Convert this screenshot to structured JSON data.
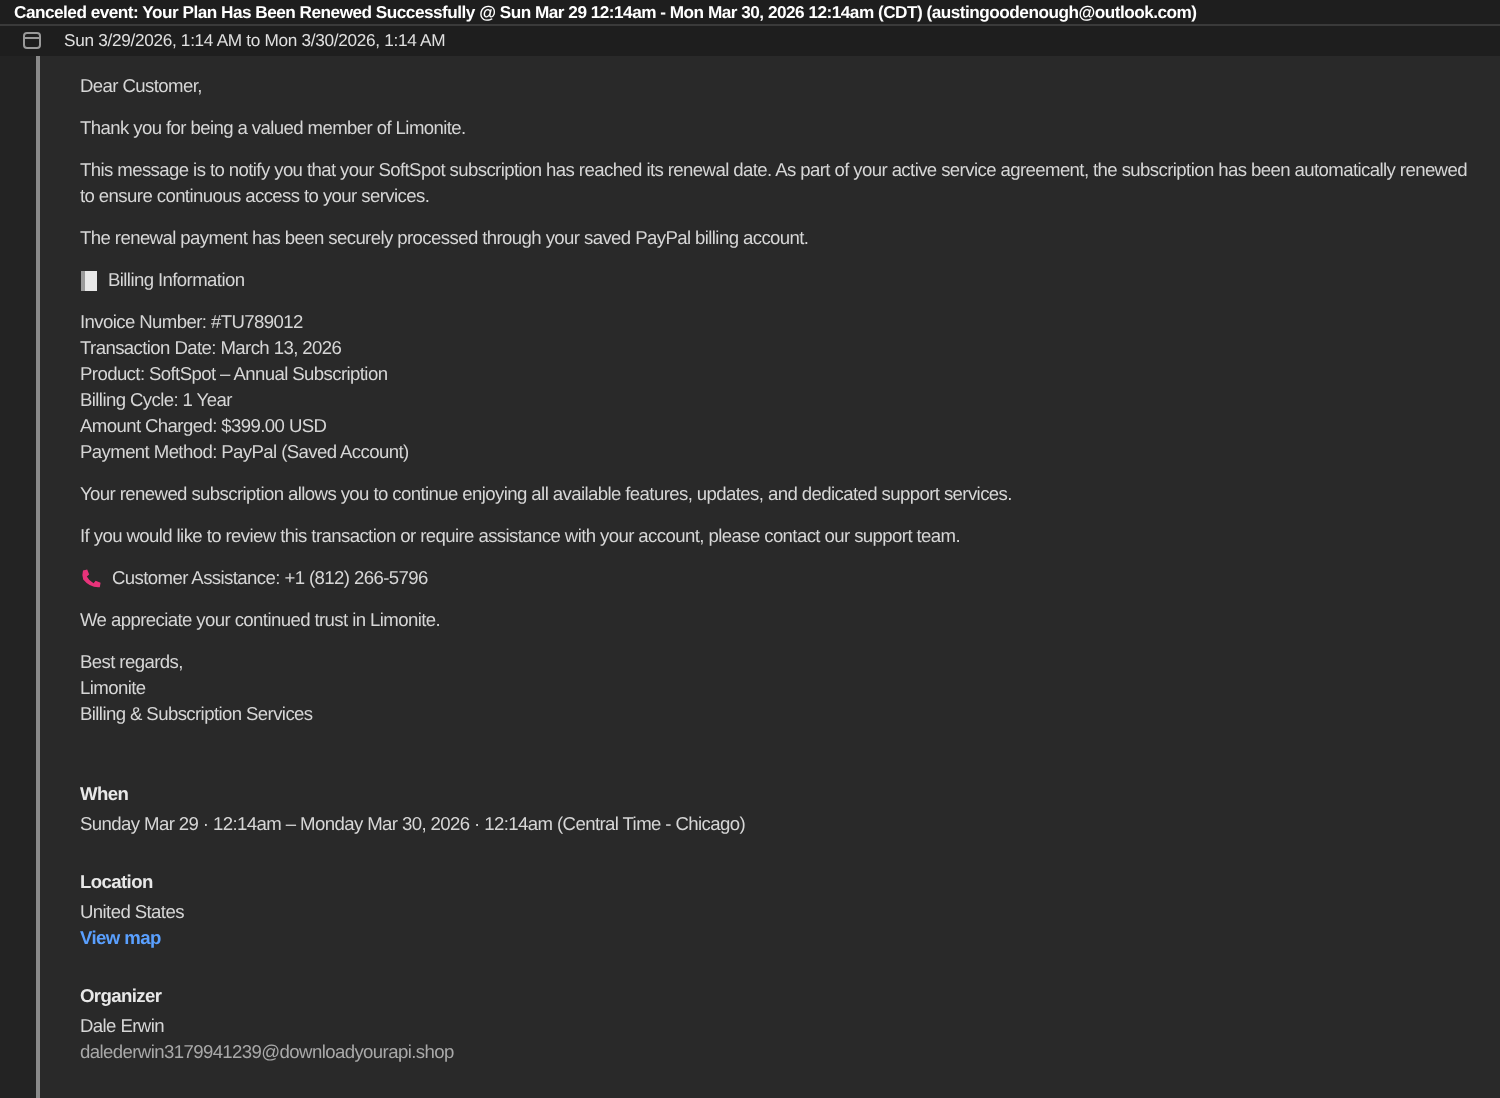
{
  "header": {
    "title": "Canceled event: Your Plan Has Been Renewed Successfully @ Sun Mar 29 12:14am - Mon Mar 30, 2026 12:14am (CDT) (austingoodenough@outlook.com)",
    "date_range": "Sun 3/29/2026, 1:14 AM to Mon 3/30/2026, 1:14 AM"
  },
  "body": [
    {
      "kind": "paragraph",
      "lines": [
        "Dear Customer,"
      ]
    },
    {
      "kind": "paragraph",
      "lines": [
        "Thank you for being a valued member of Limonite."
      ]
    },
    {
      "kind": "paragraph",
      "lines": [
        "This message is to notify you that your SoftSpot subscription has reached its renewal date. As part of your active service agreement, the subscription has been automatically renewed to ensure continuous access to your services."
      ]
    },
    {
      "kind": "paragraph",
      "lines": [
        "The renewal payment has been securely processed through your saved PayPal billing account."
      ]
    },
    {
      "kind": "billing",
      "lines": [
        "Billing Information"
      ]
    },
    {
      "kind": "paragraph",
      "lines": [
        "Invoice Number: #TU789012",
        "Transaction Date: March 13, 2026",
        "Product: SoftSpot – Annual Subscription",
        "Billing Cycle: 1 Year",
        "Amount Charged: $399.00 USD",
        "Payment Method: PayPal (Saved Account)"
      ]
    },
    {
      "kind": "paragraph",
      "lines": [
        "Your renewed subscription allows you to continue enjoying all available features, updates, and dedicated support services."
      ]
    },
    {
      "kind": "paragraph",
      "lines": [
        "If you would like to review this transaction or require assistance with your account, please contact our support team."
      ]
    },
    {
      "kind": "phone",
      "lines": [
        "Customer Assistance: +1 (812) 266-5796"
      ]
    },
    {
      "kind": "paragraph",
      "lines": [
        "We appreciate your continued trust in Limonite."
      ]
    },
    {
      "kind": "paragraph",
      "lines": [
        "Best regards,",
        "Limonite",
        "Billing & Subscription Services"
      ]
    }
  ],
  "details": [
    {
      "heading": "When",
      "lines": [
        "Sunday Mar 29 · 12:14am – Monday Mar 30, 2026 · 12:14am (Central Time - Chicago)"
      ]
    },
    {
      "heading": "Location",
      "lines": [
        "United States"
      ],
      "link": "View map"
    },
    {
      "heading": "Organizer",
      "lines": [
        "Dale Erwin"
      ],
      "email": "dalederwin3179941239@downloadyourapi.shop"
    }
  ]
}
